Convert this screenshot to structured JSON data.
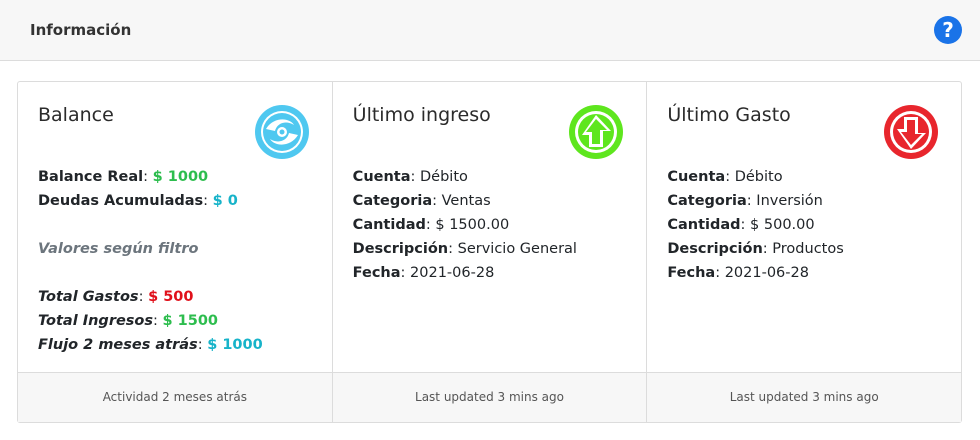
{
  "header": {
    "title": "Información"
  },
  "balance": {
    "title": "Balance",
    "rows": [
      {
        "label": "Balance Real",
        "value": "$ 1000"
      },
      {
        "label": "Deudas Acumuladas",
        "value": "$ 0"
      }
    ],
    "filter_label": "Valores según filtro",
    "filter_rows": [
      {
        "label": "Total Gastos",
        "value": "$ 500"
      },
      {
        "label": "Total Ingresos",
        "value": "$ 1500"
      },
      {
        "label": "Flujo 2 meses atrás",
        "value": "$ 1000"
      }
    ],
    "footer": "Actividad 2 meses atrás"
  },
  "last_income": {
    "title": "Último ingreso",
    "rows": [
      {
        "label": "Cuenta",
        "value": "Débito"
      },
      {
        "label": "Categoria",
        "value": "Ventas"
      },
      {
        "label": "Cantidad",
        "value": "$ 1500.00"
      },
      {
        "label": "Descripción",
        "value": "Servicio General"
      },
      {
        "label": "Fecha",
        "value": "2021-06-28"
      }
    ],
    "footer": "Last updated 3 mins ago"
  },
  "last_expense": {
    "title": "Último Gasto",
    "rows": [
      {
        "label": "Cuenta",
        "value": "Débito"
      },
      {
        "label": "Categoria",
        "value": "Inversión"
      },
      {
        "label": "Cantidad",
        "value": "$ 500.00"
      },
      {
        "label": "Descripción",
        "value": "Productos"
      },
      {
        "label": "Fecha",
        "value": "2021-06-28"
      }
    ],
    "footer": "Last updated 3 mins ago"
  },
  "colors": {
    "positive": "#2dbd4e",
    "neutral": "#17b3c9",
    "negative": "#e0101a",
    "balance_icon": "#4fc8f0",
    "income_icon": "#5ee61e",
    "expense_icon": "#e8262d",
    "help_icon": "#1a73e8"
  },
  "icons": {
    "help": "question-circle-icon",
    "balance": "hurricane-icon",
    "income": "arrow-up-circle-icon",
    "expense": "arrow-down-circle-icon"
  }
}
